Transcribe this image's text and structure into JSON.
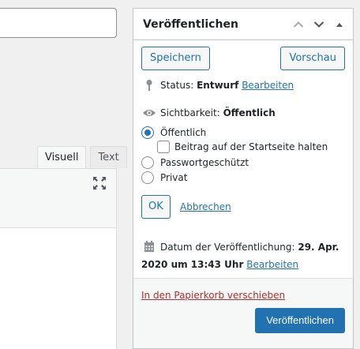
{
  "editor": {
    "tabs": [
      {
        "label": "Visuell"
      },
      {
        "label": "Text"
      }
    ]
  },
  "publish": {
    "title": "Veröffentlichen",
    "save_draft": "Speichern",
    "preview": "Vorschau",
    "status": {
      "label": "Status:",
      "value": "Entwurf",
      "edit": "Bearbeiten"
    },
    "visibility": {
      "label": "Sichtbarkeit:",
      "value": "Öffentlich",
      "options": [
        {
          "label": "Öffentlich",
          "checked": true
        },
        {
          "label": "Passwortgeschützt",
          "checked": false
        },
        {
          "label": "Privat",
          "checked": false
        }
      ],
      "sticky_label": "Beitrag auf der Startseite halten",
      "ok": "OK",
      "cancel": "Abbrechen"
    },
    "date": {
      "label": "Datum der Veröffentlichung:",
      "value": "29. Apr. 2020 um 13:43 Uhr",
      "edit": "Bearbeiten"
    },
    "trash": "In den Papierkorb verschieben",
    "publish_button": "Veröffentlichen"
  },
  "colors": {
    "accent": "#2271b1",
    "danger": "#b32d2e"
  }
}
